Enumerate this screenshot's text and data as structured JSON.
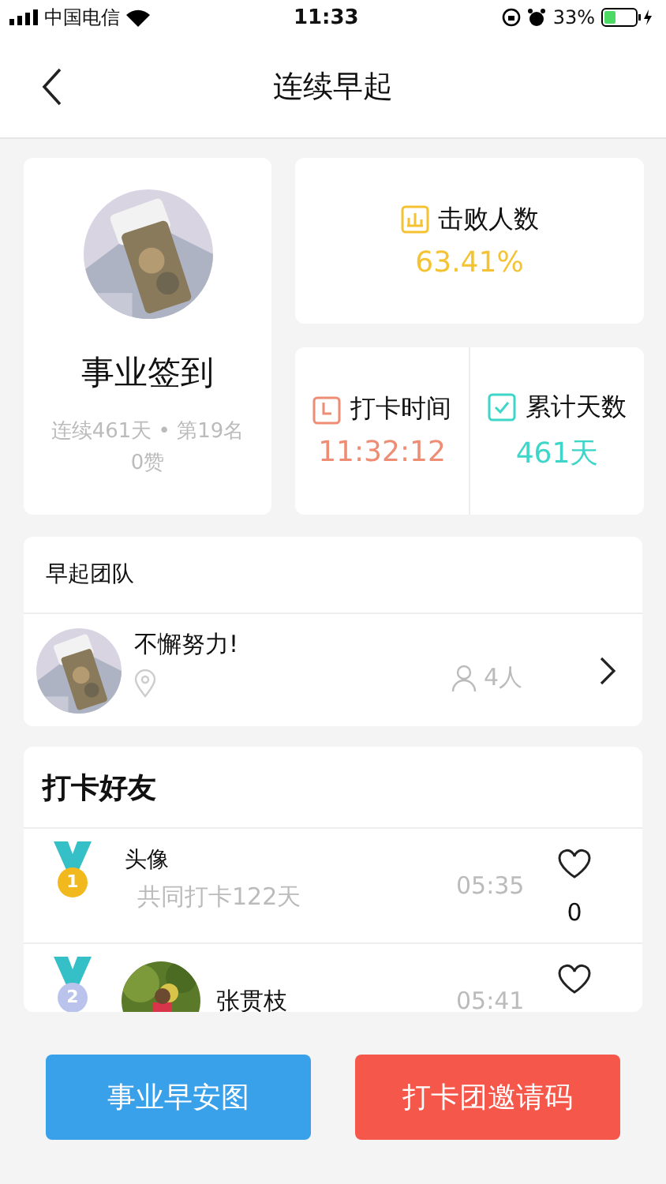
{
  "status_bar": {
    "carrier": "中国电信",
    "time": "11:33",
    "battery": "33%"
  },
  "nav": {
    "title": "连续早起"
  },
  "profile": {
    "name": "事业签到",
    "stats": "连续461天 • 第19名",
    "likes": "0赞"
  },
  "stats": [
    {
      "kind": "chart",
      "label": "击败人数",
      "value": "63.41%",
      "color": "#f5c232"
    },
    {
      "kind": "clock",
      "label": "打卡时间",
      "value": "11:32:12",
      "color": "#ee8c74"
    },
    {
      "kind": "check",
      "label": "累计天数",
      "value": "461天",
      "color": "#3dd6c8"
    }
  ],
  "team": {
    "title": "早起团队",
    "name": "不懈努力!",
    "members": "4人"
  },
  "friends": {
    "title": "打卡好友",
    "rows": [
      {
        "rank": "1",
        "color": "#f2b91e",
        "kind": "broken",
        "avatar_alt": "头像",
        "together": "共同打卡122天",
        "time": "05:35",
        "likes": "0"
      },
      {
        "rank": "2",
        "color": "#b9c3ec",
        "name": "张贯枝",
        "time": "05:41"
      }
    ]
  },
  "buttons": [
    {
      "label": "事业早安图",
      "color": "#39a0ea"
    },
    {
      "label": "打卡团邀请码",
      "color": "#f5574a"
    }
  ]
}
